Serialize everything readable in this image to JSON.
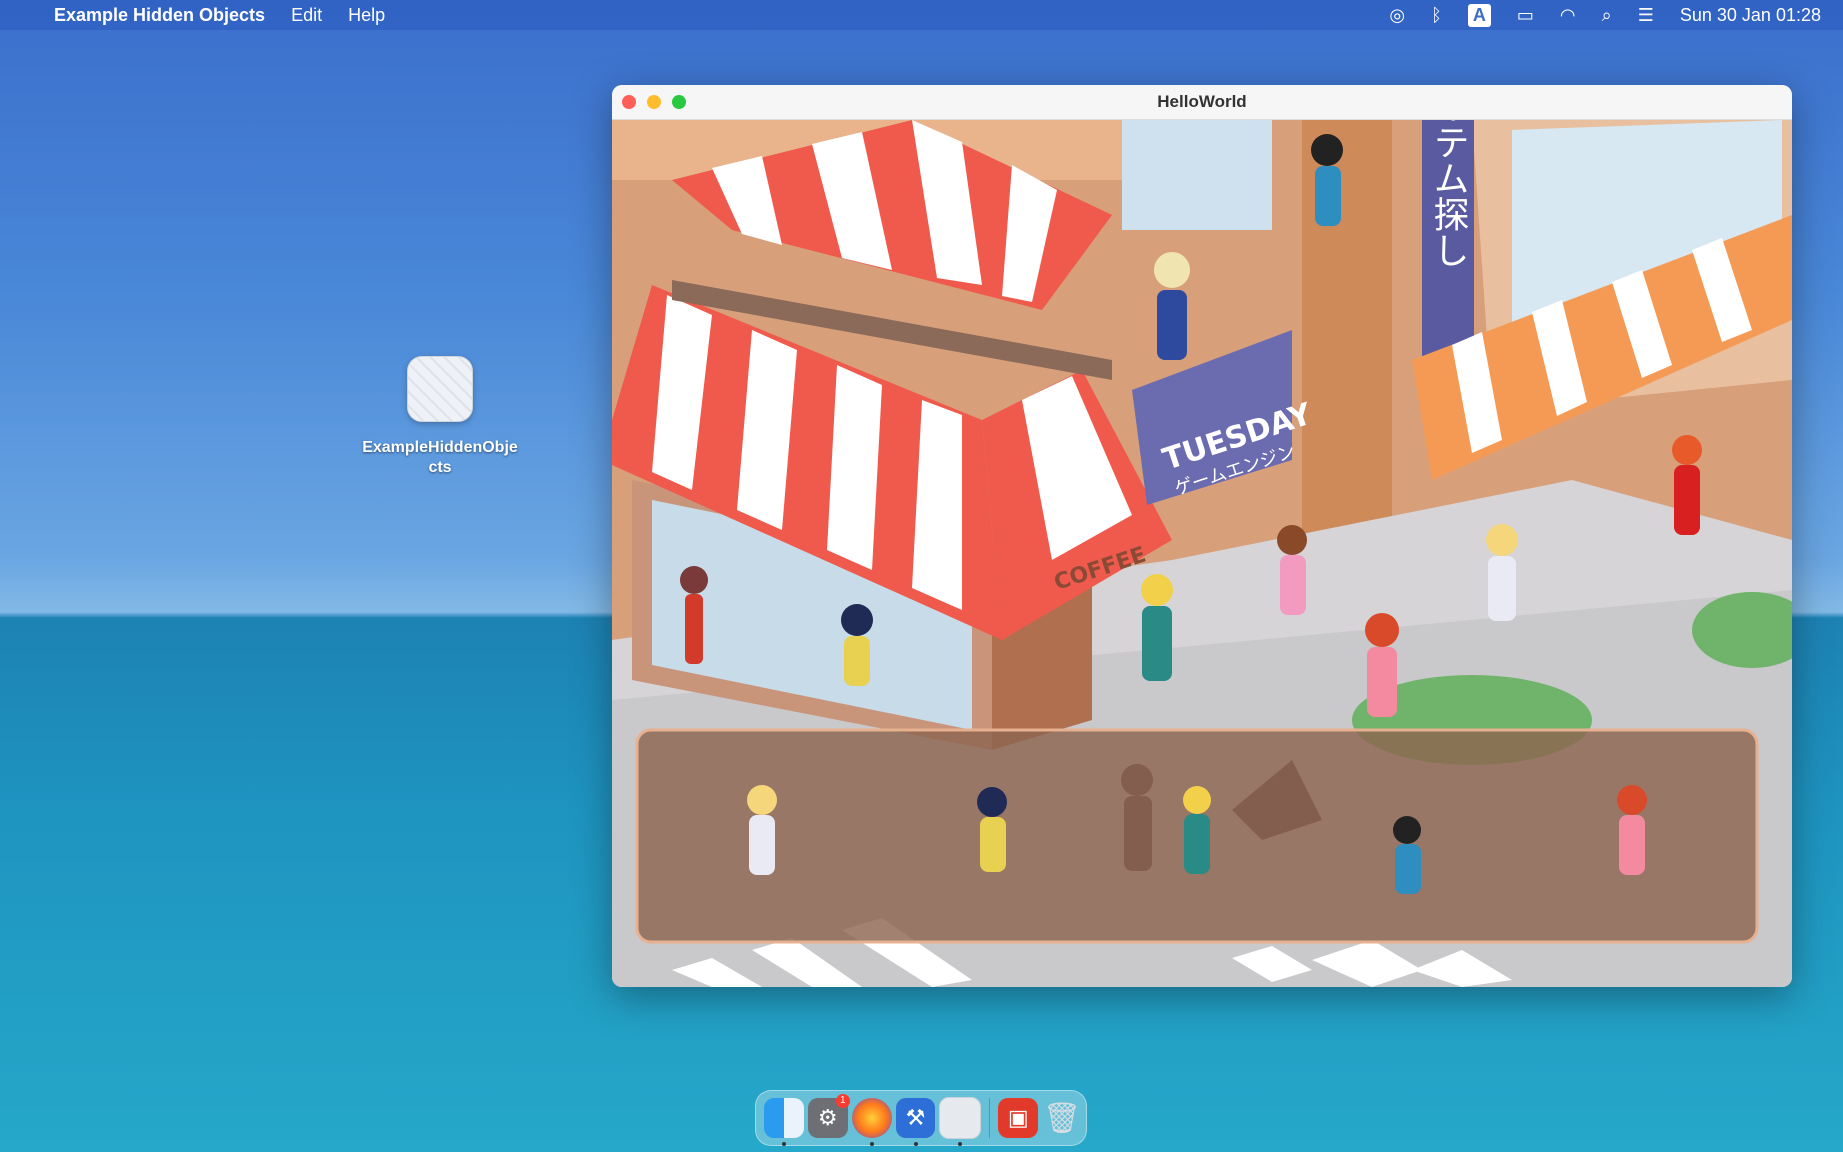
{
  "menubar": {
    "app_name": "Example Hidden Objects",
    "items": [
      "Edit",
      "Help"
    ],
    "clock": "Sun 30 Jan  01:28",
    "input_source": "A"
  },
  "desktop": {
    "icon_label": "ExampleHiddenObjects"
  },
  "window": {
    "title": "HelloWorld"
  },
  "scene": {
    "sign_vertical": "アイテム探し",
    "sign_brand": "TUESDAY",
    "sign_brand_sub": "ゲームエンジン",
    "coffee_text": "COFFEE"
  },
  "dock": {
    "badge_count": "1"
  },
  "colors": {
    "awning_red": "#ef5a4c",
    "awning_orange": "#f59a55",
    "sign_purple": "#6b6bb0",
    "tray": "#8e6550"
  }
}
